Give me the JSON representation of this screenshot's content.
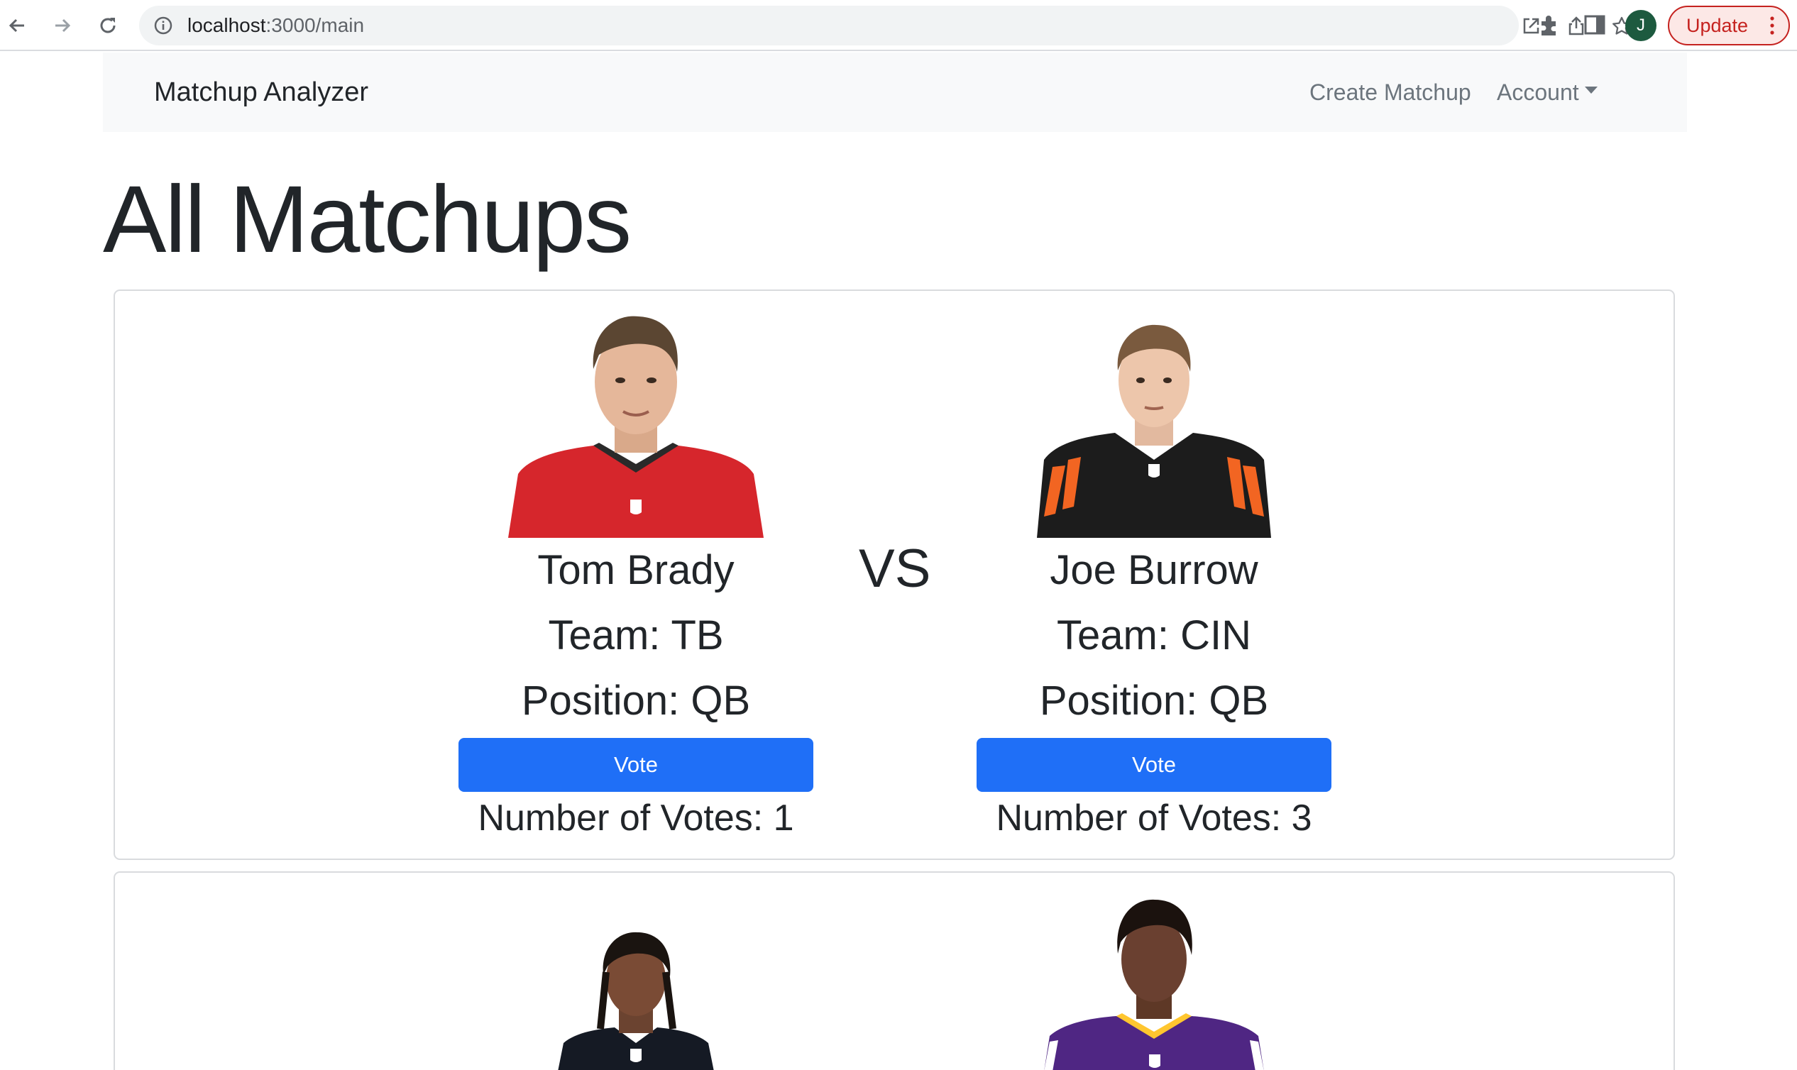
{
  "browser": {
    "url_host": "localhost",
    "url_path": ":3000/main",
    "avatar_letter": "J",
    "update_label": "Update"
  },
  "navbar": {
    "brand": "Matchup Analyzer",
    "create_matchup": "Create Matchup",
    "account": "Account"
  },
  "page": {
    "title": "All Matchups"
  },
  "matchups": [
    {
      "vs_label": "VS",
      "left": {
        "name": "Tom Brady",
        "team": "Team: TB",
        "position": "Position: QB",
        "vote_label": "Vote",
        "votes": "Number of Votes: 1",
        "jersey_color": "#d6262c"
      },
      "right": {
        "name": "Joe Burrow",
        "team": "Team: CIN",
        "position": "Position: QB",
        "vote_label": "Vote",
        "votes": "Number of Votes: 3",
        "jersey_color": "#1c1c1c"
      }
    },
    {
      "left": {
        "jersey_color": "#151a24"
      },
      "right": {
        "jersey_color": "#4f2683"
      }
    }
  ],
  "colors": {
    "primary_button": "#1f6ff7",
    "navbar_bg": "#f8f9fa",
    "update_red": "#c5221f"
  }
}
